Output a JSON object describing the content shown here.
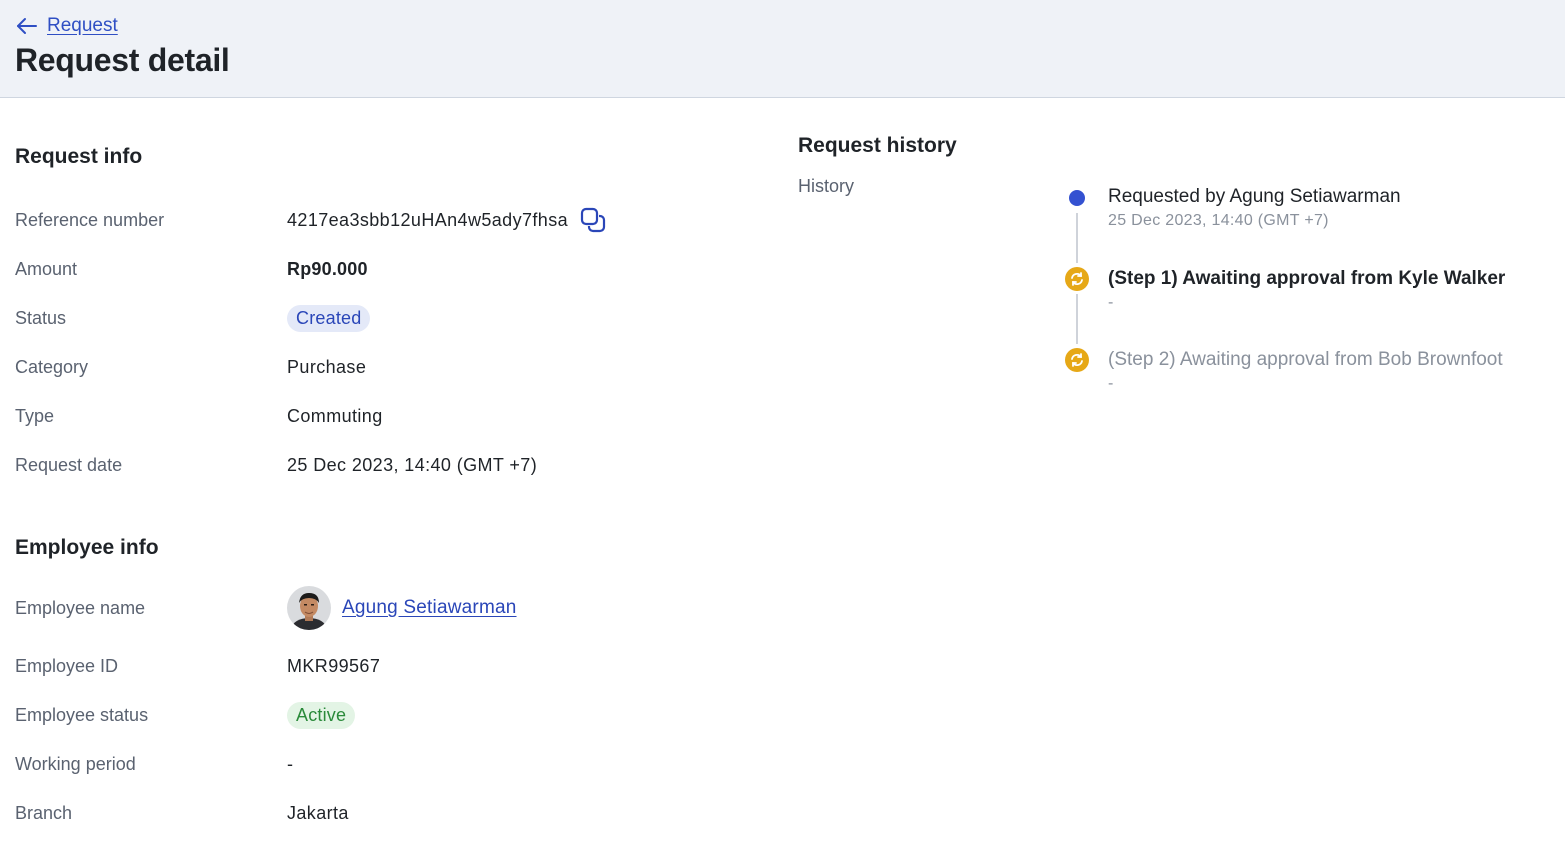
{
  "header": {
    "back_label": "Request",
    "title": "Request detail"
  },
  "request_info": {
    "title": "Request info",
    "reference_label": "Reference number",
    "reference_value": "4217ea3sbb12uHAn4w5ady7fhsa",
    "amount_label": "Amount",
    "amount_value": "Rp90.000",
    "status_label": "Status",
    "status_value": "Created",
    "category_label": "Category",
    "category_value": "Purchase",
    "type_label": "Type",
    "type_value": "Commuting",
    "date_label": "Request date",
    "date_value": "25 Dec 2023, 14:40 (GMT +7)"
  },
  "employee_info": {
    "title": "Employee info",
    "name_label": "Employee name",
    "name_value": "Agung Setiawarman",
    "id_label": "Employee ID",
    "id_value": "MKR99567",
    "status_label": "Employee status",
    "status_value": "Active",
    "period_label": "Working period",
    "period_value": "-",
    "branch_label": "Branch",
    "branch_value": "Jakarta"
  },
  "request_history": {
    "title": "Request history",
    "history_label": "History",
    "events": [
      {
        "title": "Requested by Agung Setiawarman",
        "subtitle": "25 Dec 2023, 14:40 (GMT +7)",
        "state": "done"
      },
      {
        "title": "(Step 1) Awaiting approval from Kyle Walker",
        "subtitle": "-",
        "state": "current"
      },
      {
        "title": "(Step 2) Awaiting approval from Bob Brownfoot",
        "subtitle": "-",
        "state": "pending"
      }
    ]
  },
  "colors": {
    "accent": "#2f4fc4",
    "created_badge_bg": "#e4e9f8",
    "active_badge_bg": "#e3f4e5",
    "step_pending": "#e6a817",
    "header_bg": "#eff2f7"
  },
  "icons": {
    "back": "arrow-left-icon",
    "copy": "copy-icon",
    "step": "refresh-icon"
  }
}
